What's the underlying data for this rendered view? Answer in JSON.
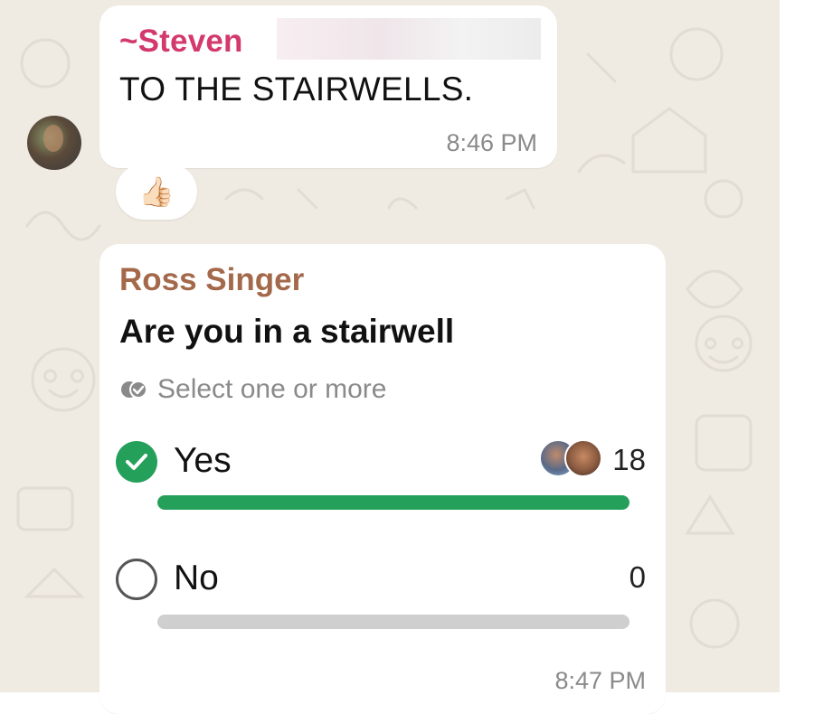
{
  "colors": {
    "chat_background": "#efeae2",
    "bubble": "#ffffff",
    "sender_steven": "#d3396d",
    "sender_ross": "#a4684a",
    "poll_accent": "#25a05b",
    "bar_empty": "#cfcfcf",
    "timestamp": "#8a8a8a"
  },
  "messages": [
    {
      "sender": "~Steven",
      "text": "TO THE STAIRWELLS.",
      "time": "8:46 PM",
      "reaction": "👍🏻",
      "avatar_icon": "profile-photo"
    },
    {
      "sender": "Ross Singer",
      "poll": {
        "question": "Are you in a stairwell",
        "hint": "Select one or more",
        "hint_icon": "double-check-icon",
        "options": [
          {
            "label": "Yes",
            "votes": "18",
            "selected": true,
            "fill_fraction": 1.0,
            "voters": [
              "voter-avatar",
              "voter-avatar"
            ]
          },
          {
            "label": "No",
            "votes": "0",
            "selected": false,
            "fill_fraction": 0.0
          }
        ]
      },
      "time": "8:47 PM"
    }
  ]
}
